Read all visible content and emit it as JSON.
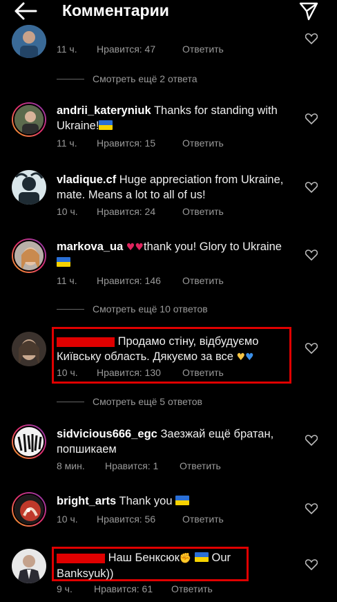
{
  "header": {
    "title": "Комментарии"
  },
  "comments": [
    {
      "username": "…",
      "text": "",
      "time": "11 ч.",
      "likes": "Нравится: 47",
      "reply": "Ответить",
      "more": "Смотреть ещё 2 ответа"
    },
    {
      "username": "andrii_kateryniuk",
      "text": "Thanks for standing with Ukraine!",
      "time": "11 ч.",
      "likes": "Нравится: 15",
      "reply": "Ответить"
    },
    {
      "username": "vladique.cf",
      "text": "Huge appreciation from Ukraine, mate. Means a lot to all of us!",
      "time": "10 ч.",
      "likes": "Нравится: 24",
      "reply": "Ответить"
    },
    {
      "username": "markova_ua",
      "text": "thank you! Glory to Ukraine",
      "time": "11 ч.",
      "likes": "Нравится: 146",
      "reply": "Ответить",
      "more": "Смотреть ещё 10 ответов"
    },
    {
      "username": "",
      "text": "Продамо стіну, відбудуємо Київську область. Дякуємо за все",
      "time": "10 ч.",
      "likes": "Нравится: 130",
      "reply": "Ответить",
      "more": "Смотреть ещё 5 ответов"
    },
    {
      "username": "sidvicious666_egc",
      "text": "Заезжай ещё братан, попшикаем",
      "time": "8 мин.",
      "likes": "Нравится: 1",
      "reply": "Ответить"
    },
    {
      "username": "bright_arts",
      "text": "Thank you",
      "time": "10 ч.",
      "likes": "Нравится: 56",
      "reply": "Ответить"
    },
    {
      "username": "",
      "text_a": "Наш Бенксюк",
      "text_b": "Our Banksyuk))",
      "time": "9 ч.",
      "likes": "Нравится: 61",
      "reply": "Ответить"
    }
  ],
  "colors": {
    "highlight": "#e00000",
    "flag_blue": "#2a6fd6",
    "flag_yellow": "#f6d200"
  }
}
